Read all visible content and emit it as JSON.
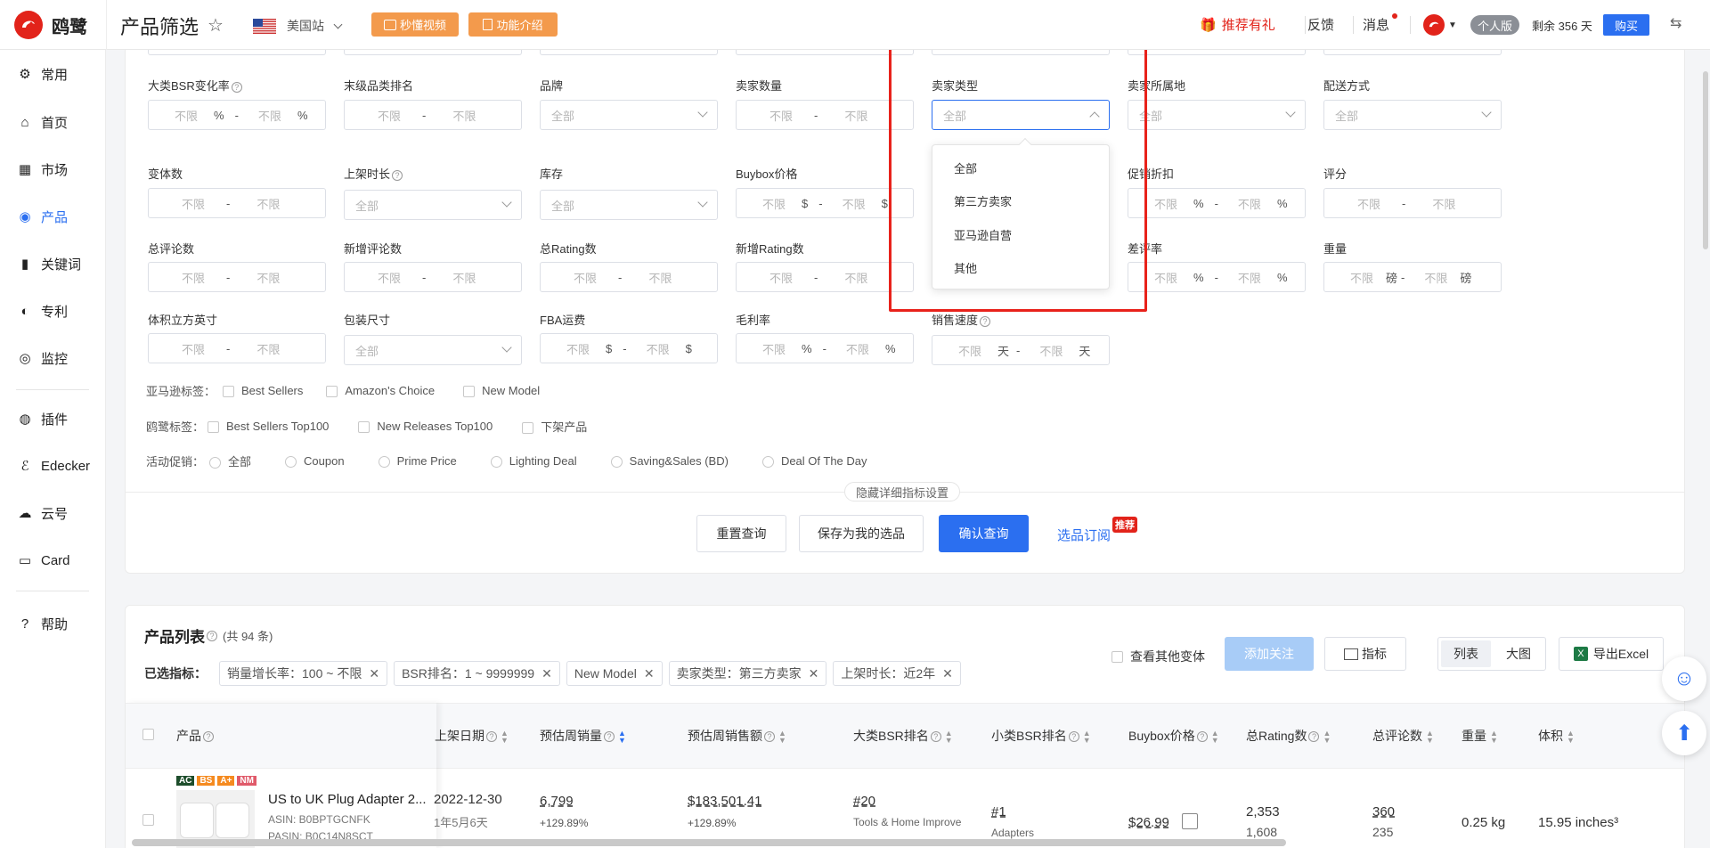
{
  "app": {
    "logo_text": "鸥鹭",
    "page_title": "产品筛选",
    "site": "美国站"
  },
  "header": {
    "video_btn": "秒懂视频",
    "intro_btn": "功能介绍",
    "referral": "推荐有礼",
    "feedback": "反馈",
    "messages": "消息",
    "plan_badge": "个人版",
    "remaining": "剩余 356 天",
    "buy": "购买"
  },
  "sidebar": {
    "items": [
      {
        "label": "常用",
        "icon": "gear-icon"
      },
      {
        "label": "首页",
        "icon": "home-icon"
      },
      {
        "label": "市场",
        "icon": "grid-icon"
      },
      {
        "label": "产品",
        "icon": "eye-icon"
      },
      {
        "label": "关键词",
        "icon": "bar-chart-icon"
      },
      {
        "label": "专利",
        "icon": "patent-icon"
      },
      {
        "label": "监控",
        "icon": "monitor-icon"
      },
      {
        "label": "插件",
        "icon": "chrome-icon"
      },
      {
        "label": "Edecker",
        "icon": "edecker-icon"
      },
      {
        "label": "云号",
        "icon": "cloud-icon"
      },
      {
        "label": "Card",
        "icon": "card-icon"
      },
      {
        "label": "帮助",
        "icon": "help-icon"
      }
    ]
  },
  "filters": {
    "any": "不限",
    "all": "全部",
    "labels": {
      "bsr_change": "大类BSR变化率",
      "leaf_rank": "末级品类排名",
      "brand": "品牌",
      "seller_count": "卖家数量",
      "seller_type": "卖家类型",
      "seller_location": "卖家所属地",
      "delivery": "配送方式",
      "variants": "变体数",
      "listing_age": "上架时长",
      "stock": "库存",
      "buybox_price": "Buybox价格",
      "promo_discount": "促销折扣",
      "rating": "评分",
      "total_reviews": "总评论数",
      "new_reviews": "新增评论数",
      "total_ratings": "总Rating数",
      "new_ratings": "新增Rating数",
      "bad_rate": "差评率",
      "weight": "重量",
      "volume": "体积立方英寸",
      "package_size": "包装尺寸",
      "fba_fee": "FBA运费",
      "gross_margin": "毛利率",
      "sales_speed": "销售速度"
    },
    "units": {
      "pct": "%",
      "usd": "$",
      "lb": "磅",
      "day": "天"
    },
    "amazon_tags_label": "亚马逊标签：",
    "amazon_tags": [
      "Best Sellers",
      "Amazon's Choice",
      "New Model"
    ],
    "oulu_tags_label": "鸥鹭标签：",
    "oulu_tags": [
      "Best Sellers Top100",
      "New Releases Top100",
      "下架产品"
    ],
    "promo_label": "活动促销：",
    "promos": [
      "全部",
      "Coupon",
      "Prime Price",
      "Lighting Deal",
      "Saving&Sales (BD)",
      "Deal Of The Day"
    ],
    "hide_detail": "隐藏详细指标设置",
    "dropdown_options": [
      "全部",
      "第三方卖家",
      "亚马逊自营",
      "其他"
    ]
  },
  "actions": {
    "reset": "重置查询",
    "save": "保存为我的选品",
    "confirm": "确认查询",
    "subscribe": "选品订阅",
    "recommend_badge": "推荐"
  },
  "product_list": {
    "title": "产品列表",
    "count": "(共 94 条)",
    "selected_label": "已选指标：",
    "chips": [
      "销量增长率：100 ~ 不限",
      "BSR排名：1 ~ 9999999",
      "New Model",
      "卖家类型：第三方卖家",
      "上架时长：近2年"
    ],
    "other_variants": "查看其他变体",
    "add_follow": "添加关注",
    "metrics": "指标",
    "view_list": "列表",
    "view_large": "大图",
    "export": "导出Excel",
    "columns": [
      "产品",
      "上架日期",
      "预估周销量",
      "预估周销售额",
      "大类BSR排名",
      "小类BSR排名",
      "Buybox价格",
      "总Rating数",
      "总评论数",
      "重量",
      "体积"
    ],
    "row": {
      "badges": [
        "AC",
        "BS",
        "A+",
        "NM"
      ],
      "title": "US to UK Plug Adapter 2...",
      "asin": "ASIN: B0BPTGCNFK",
      "pasin": "PASIN: B0C14N8SCT",
      "date": "2022-12-30",
      "age": "1年5月6天",
      "weekly_sales": "6,799",
      "weekly_sales_growth": "+129.89%",
      "weekly_revenue": "$183,501.41",
      "weekly_revenue_growth": "+129.89%",
      "bsr_main": "#20",
      "bsr_main_cat": "Tools & Home Improve",
      "bsr_sub": "#1",
      "bsr_sub_cat": "Adapters",
      "buybox": "$26.99",
      "ratings": "2,353",
      "ratings2": "1,608",
      "reviews": "360",
      "reviews2": "235",
      "weight": "0.25 kg",
      "volume": "15.95 inches³"
    }
  },
  "colors": {
    "accent": "#2b6ff0",
    "brand_red": "#e2231a",
    "highlight_box": "#e8221b",
    "orange_btn": "#f39a4c"
  }
}
